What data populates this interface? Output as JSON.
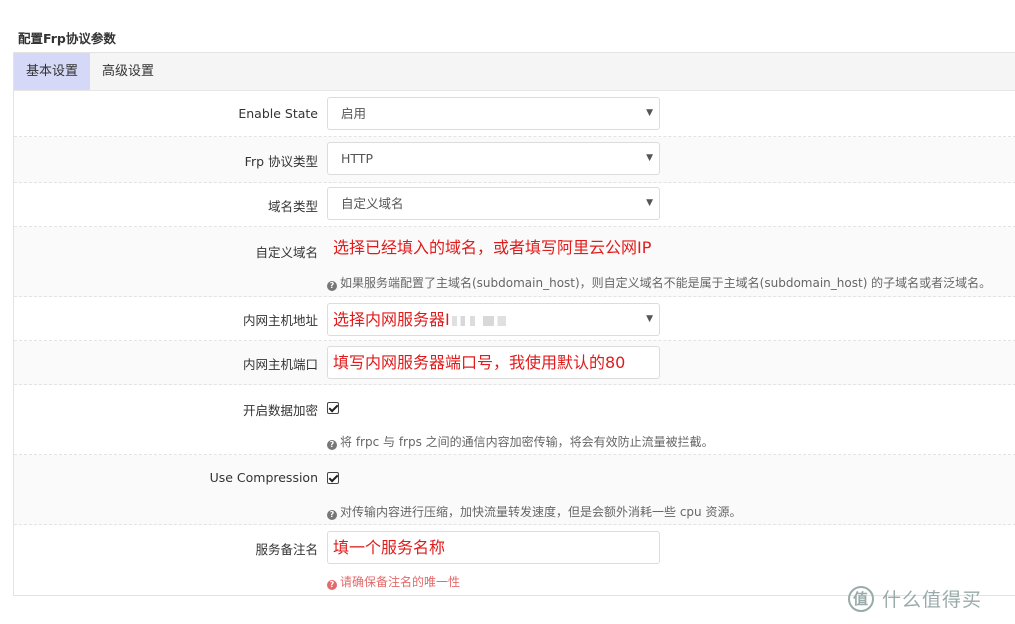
{
  "section_title": "配置Frp协议参数",
  "tabs": [
    {
      "label": "基本设置",
      "active": true
    },
    {
      "label": "高级设置",
      "active": false
    }
  ],
  "fields": {
    "enable_state": {
      "label": "Enable State",
      "value": "启用"
    },
    "protocol_type": {
      "label": "Frp 协议类型",
      "value": "HTTP"
    },
    "domain_type": {
      "label": "域名类型",
      "value": "自定义域名"
    },
    "custom_domain": {
      "label": "自定义域名",
      "annotation": "选择已经填入的域名，或者填写阿里云公网IP",
      "help": "如果服务端配置了主域名(subdomain_host)，则自定义域名不能是属于主域名(subdomain_host) 的子域名或者泛域名。"
    },
    "local_host": {
      "label": "内网主机地址",
      "annotation": "选择内网服务器I"
    },
    "local_port": {
      "label": "内网主机端口",
      "annotation": "填写内网服务器端口号，我使用默认的80"
    },
    "encryption": {
      "label": "开启数据加密",
      "checked": true,
      "help": "将 frpc 与 frps 之间的通信内容加密传输，将会有效防止流量被拦截。"
    },
    "compression": {
      "label": "Use Compression",
      "checked": true,
      "help": "对传输内容进行压缩，加快流量转发速度，但是会额外消耗一些 cpu 资源。"
    },
    "service_remark": {
      "label": "服务备注名",
      "annotation": "填一个服务名称",
      "help": "请确保备注名的唯一性"
    }
  },
  "icons": {
    "help": "question-circle-icon",
    "select": "caret-down-icon",
    "check": "check-icon"
  },
  "colors": {
    "active_tab": "#d5d8f7",
    "annotation": "#e11b1b",
    "error_help": "#e36a6a"
  },
  "watermark": {
    "logo": "值",
    "text": "什么值得买"
  }
}
